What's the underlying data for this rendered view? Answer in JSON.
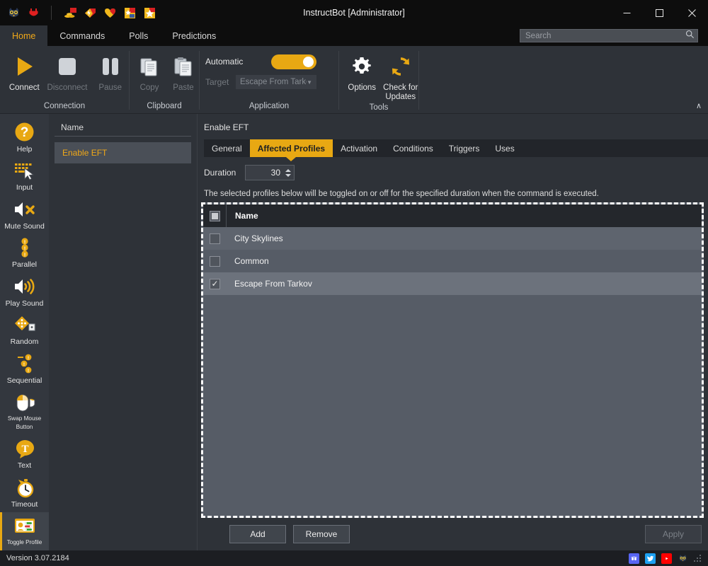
{
  "window": {
    "title": "InstructBot [Administrator]",
    "minimize_label": "–",
    "maximize_label": "□",
    "close_label": "✕",
    "quick_access_icons": [
      "owl-logo-icon",
      "plug-icon",
      "coins-icon",
      "lightning-tag-icon",
      "heart-icon",
      "star-tag-icon",
      "star-icon"
    ]
  },
  "ribbon": {
    "tabs": [
      {
        "label": "Home",
        "active": true
      },
      {
        "label": "Commands",
        "active": false
      },
      {
        "label": "Polls",
        "active": false
      },
      {
        "label": "Predictions",
        "active": false
      }
    ],
    "search": {
      "placeholder": "Search",
      "value": ""
    },
    "collapse_label": "∧",
    "groups": [
      {
        "label": "Connection",
        "buttons": [
          {
            "label": "Connect",
            "icon": "play-icon",
            "disabled": false
          },
          {
            "label": "Disconnect",
            "icon": "stop-icon",
            "disabled": true
          },
          {
            "label": "Pause",
            "icon": "pause-icon",
            "disabled": true
          }
        ]
      },
      {
        "label": "Clipboard",
        "buttons": [
          {
            "label": "Copy",
            "icon": "copy-icon",
            "disabled": true
          },
          {
            "label": "Paste",
            "icon": "paste-icon",
            "disabled": true
          }
        ]
      },
      {
        "label": "Application",
        "automatic_label": "Automatic",
        "automatic_on": true,
        "target_label": "Target",
        "target_value": "Escape From Tarkov",
        "target_disabled": true
      },
      {
        "label": "Tools",
        "buttons": [
          {
            "label": "Options",
            "icon": "gear-icon",
            "disabled": false
          },
          {
            "label": "Check for Updates",
            "icon": "refresh-icon",
            "disabled": false
          }
        ]
      }
    ]
  },
  "sidebar": {
    "items": [
      {
        "label": "Help",
        "icon": "help-icon",
        "active": false
      },
      {
        "label": "Input",
        "icon": "keyboard-cursor-icon",
        "active": false
      },
      {
        "label": "Mute Sound",
        "icon": "mute-sound-icon",
        "active": false
      },
      {
        "label": "Parallel",
        "icon": "parallel-icon",
        "active": false
      },
      {
        "label": "Play Sound",
        "icon": "play-sound-icon",
        "active": false
      },
      {
        "label": "Random",
        "icon": "random-dice-icon",
        "active": false
      },
      {
        "label": "Sequential",
        "icon": "sequential-icon",
        "active": false
      },
      {
        "label": "Swap Mouse Button",
        "icon": "mouse-icon",
        "active": false,
        "tiny": true
      },
      {
        "label": "Text",
        "icon": "text-bubble-icon",
        "active": false
      },
      {
        "label": "Timeout",
        "icon": "stopwatch-icon",
        "active": false
      },
      {
        "label": "Toggle Profile",
        "icon": "toggle-profile-icon",
        "active": true,
        "tiny": true
      }
    ]
  },
  "command_list": {
    "header": "Name",
    "rows": [
      {
        "label": "Enable EFT",
        "selected": true
      }
    ]
  },
  "detail": {
    "title": "Enable EFT",
    "tabs": [
      {
        "label": "General",
        "active": false
      },
      {
        "label": "Affected Profiles",
        "active": true
      },
      {
        "label": "Activation",
        "active": false
      },
      {
        "label": "Conditions",
        "active": false
      },
      {
        "label": "Triggers",
        "active": false
      },
      {
        "label": "Uses",
        "active": false
      }
    ],
    "duration_label": "Duration",
    "duration_value": "30",
    "hint": "The selected profiles below will be toggled on or off for the specified duration when the command is executed.",
    "table": {
      "header_checkbox_state": "indeterminate",
      "columns": [
        "Name"
      ],
      "rows": [
        {
          "name": "City Skylines",
          "checked": false
        },
        {
          "name": "Common",
          "checked": false
        },
        {
          "name": "Escape From Tarkov",
          "checked": true
        }
      ]
    },
    "buttons": {
      "add": "Add",
      "remove": "Remove",
      "apply": "Apply",
      "apply_disabled": true
    }
  },
  "status_bar": {
    "version": "Version 3.07.2184",
    "social_icons": [
      "discord-icon",
      "twitter-icon",
      "youtube-icon",
      "owl-logo-icon"
    ]
  },
  "colors": {
    "accent": "#e8a813",
    "titlebar_bg": "#0d0d0d",
    "app_bg": "#2e3238",
    "list_bg": "#565c66",
    "selected_text": "#f0a818"
  }
}
